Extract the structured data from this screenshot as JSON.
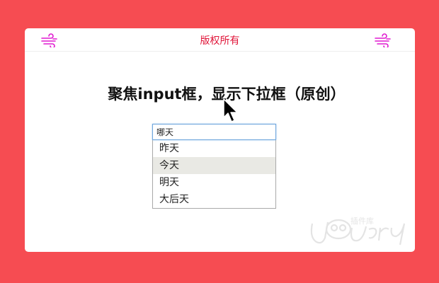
{
  "header": {
    "copyright": "版权所有",
    "left_icon": "wind-icon",
    "right_icon": "wind-icon",
    "icon_color": "#e01ad0"
  },
  "main": {
    "title": "聚焦input框，显示下拉框（原创）",
    "input": {
      "value": "哪天",
      "placeholder": ""
    },
    "dropdown": {
      "options": [
        "昨天",
        "今天",
        "明天",
        "大后天"
      ],
      "highlighted_index": 1
    }
  },
  "watermark": {
    "text": "jQuery",
    "subtext": "插件库"
  },
  "colors": {
    "background": "#f64c52",
    "card": "#ffffff",
    "accent": "#e0163a"
  }
}
